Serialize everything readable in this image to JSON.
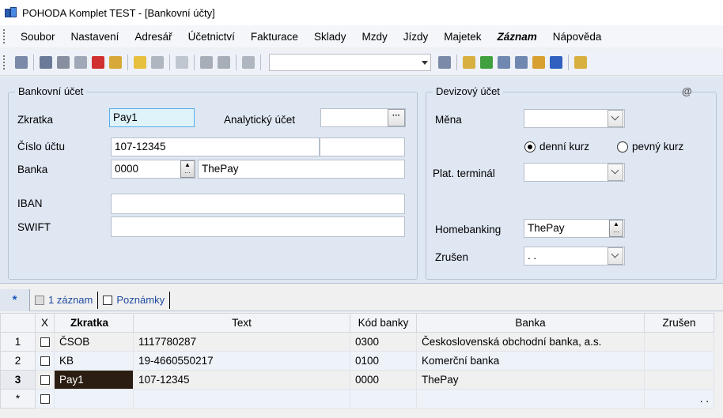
{
  "window": {
    "title": "POHODA Komplet TEST - [Bankovní účty]"
  },
  "menu": [
    "Soubor",
    "Nastavení",
    "Adresář",
    "Účetnictví",
    "Fakturace",
    "Sklady",
    "Mzdy",
    "Jízdy",
    "Majetek",
    "Záznam",
    "Nápověda"
  ],
  "form": {
    "bank_account_legend": "Bankovní účet",
    "zkratka_label": "Zkratka",
    "zkratka_value": "Pay1",
    "analyticky_label": "Analytický účet",
    "cislo_label": "Číslo účtu",
    "cislo_value": "107-12345",
    "banka_label": "Banka",
    "banka_code": "0000",
    "banka_name": "ThePay",
    "iban_label": "IBAN",
    "swift_label": "SWIFT",
    "foreign_legend": "Devizový účet",
    "at_sign": "@",
    "mena_label": "Měna",
    "radio_daily": "denní kurz",
    "radio_fixed": "pevný kurz",
    "terminal_label": "Plat. terminál",
    "homebanking_label": "Homebanking",
    "homebanking_value": "ThePay",
    "zrusen_label": "Zrušen",
    "zrusen_value": ". ."
  },
  "tabs": {
    "new": "*",
    "records": "1 záznam",
    "notes": "Poznámky"
  },
  "grid": {
    "headers": {
      "x": "X",
      "zkratka": "Zkratka",
      "text": "Text",
      "kod": "Kód banky",
      "banka": "Banka",
      "zrusen": "Zrušen"
    },
    "rows": [
      {
        "n": "1",
        "zkratka": "ČSOB",
        "text": "1117780287",
        "kod": "0300",
        "banka": "Československá obchodní banka, a.s."
      },
      {
        "n": "2",
        "zkratka": "KB",
        "text": "19-4660550217",
        "kod": "0100",
        "banka": "Komerční banka"
      },
      {
        "n": "3",
        "zkratka": "Pay1",
        "text": "107-12345",
        "kod": "0000",
        "banka": "ThePay"
      }
    ],
    "new_row_marker": "*",
    "new_row_zrusen": ". ."
  }
}
